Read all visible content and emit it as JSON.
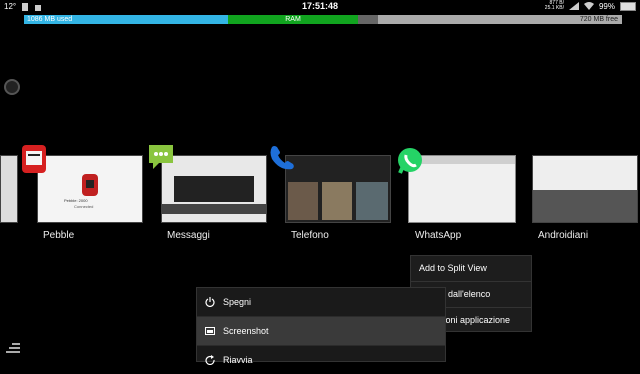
{
  "status": {
    "temp": "12°",
    "time": "17:51:48",
    "net_up": "877 B/",
    "net_down": "25.1 KB/",
    "battery": "99%"
  },
  "ram_bar": {
    "used": "1086 MB used",
    "center": "RAM",
    "free": "720 MB free"
  },
  "recents": [
    {
      "label": "Pebble"
    },
    {
      "label": "Messaggi"
    },
    {
      "label": "Telefono"
    },
    {
      "label": "WhatsApp"
    },
    {
      "label": "Androidiani"
    }
  ],
  "thumb_text": {
    "pebble_status": "Pebble: 2000",
    "pebble_line": "Connected"
  },
  "context_menu": {
    "items": [
      "Add to Split View",
      "uovi dall'elenco",
      "nazioni applicazione"
    ]
  },
  "power_menu": {
    "items": [
      "Spegni",
      "Screenshot",
      "Riavvia"
    ]
  },
  "colors": {
    "ram_used": "#33b5e5",
    "ram_mid": "#11a41f",
    "ram_free": "#aaaaaa",
    "whatsapp": "#25d366",
    "messages": "#8ac53f",
    "phone": "#1e6fd9",
    "pebble": "#d62020"
  }
}
